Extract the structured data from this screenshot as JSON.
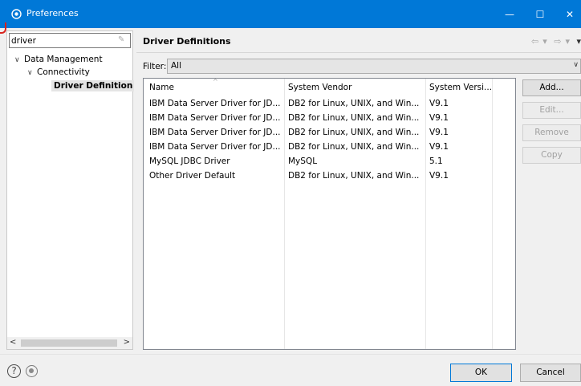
{
  "window": {
    "title": "Preferences",
    "controls": {
      "minimize": "—",
      "maximize": "☐",
      "close": "✕"
    }
  },
  "sidebar": {
    "search": {
      "value": "driver",
      "placeholder": ""
    },
    "tree": {
      "data_management": "Data Management",
      "connectivity": "Connectivity",
      "driver_definitions": "Driver Definition"
    }
  },
  "main": {
    "title": "Driver Definitions",
    "filter_label": "Filter:",
    "filter_value": "All",
    "columns": [
      "Name",
      "System Vendor",
      "System Versi..."
    ],
    "rows": [
      [
        "IBM Data Server Driver for JD...",
        "DB2 for Linux, UNIX, and Win...",
        "V9.1"
      ],
      [
        "IBM Data Server Driver for JD...",
        "DB2 for Linux, UNIX, and Win...",
        "V9.1"
      ],
      [
        "IBM Data Server Driver for JD...",
        "DB2 for Linux, UNIX, and Win...",
        "V9.1"
      ],
      [
        "IBM Data Server Driver for JD...",
        "DB2 for Linux, UNIX, and Win...",
        "V9.1"
      ],
      [
        "MySQL JDBC Driver",
        "MySQL",
        "5.1"
      ],
      [
        "Other Driver Default",
        "DB2 for Linux, UNIX, and Win...",
        "V9.1"
      ]
    ],
    "buttons": {
      "add": "Add...",
      "edit": "Edit...",
      "remove": "Remove",
      "copy": "Copy"
    }
  },
  "footer": {
    "ok": "OK",
    "cancel": "Cancel"
  },
  "colors": {
    "titlebar": "#0078d7",
    "accent": "#0078d7",
    "selection": "#e5e5e5"
  }
}
